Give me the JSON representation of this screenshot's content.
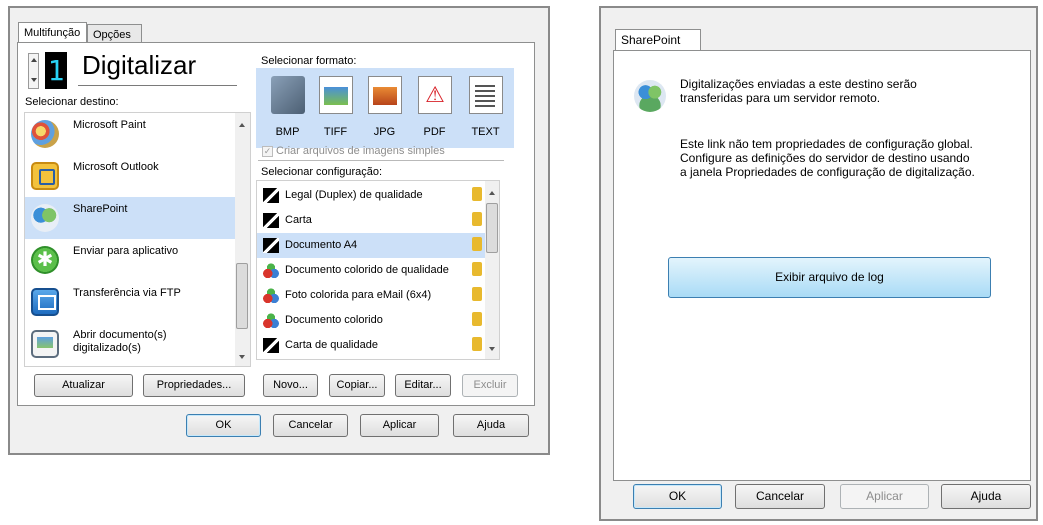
{
  "left_dialog": {
    "tabs": [
      "Multifunção",
      "Opções"
    ],
    "digit": "1",
    "title": "Digitalizar",
    "select_destination_label": "Selecionar destino:",
    "destinations": [
      {
        "label": "Microsoft Paint",
        "icon": "paint-icon"
      },
      {
        "label": "Microsoft Outlook",
        "icon": "outlook-icon"
      },
      {
        "label": "SharePoint",
        "icon": "sharepoint-icon",
        "selected": true
      },
      {
        "label": "Enviar para aplicativo",
        "icon": "send-app-icon"
      },
      {
        "label": "Transferência via FTP",
        "icon": "ftp-icon"
      },
      {
        "label": "Abrir documento(s) digitalizado(s)",
        "icon": "open-document-icon"
      }
    ],
    "select_format_label": "Selecionar formato:",
    "formats": [
      "BMP",
      "TIFF",
      "JPG",
      "PDF",
      "TEXT"
    ],
    "single_image_checkbox": "Criar arquivos de imagens simples",
    "select_config_label": "Selecionar configuração:",
    "configs": [
      {
        "label": "Legal (Duplex) de qualidade",
        "kind": "bw"
      },
      {
        "label": "Carta",
        "kind": "bw"
      },
      {
        "label": "Documento A4",
        "kind": "bw",
        "selected": true
      },
      {
        "label": "Documento colorido de qualidade",
        "kind": "color"
      },
      {
        "label": "Foto colorida para eMail (6x4)",
        "kind": "color"
      },
      {
        "label": "Documento colorido",
        "kind": "color"
      },
      {
        "label": "Carta de qualidade",
        "kind": "bw"
      }
    ],
    "buttons": {
      "update": "Atualizar",
      "properties": "Propriedades...",
      "new": "Novo...",
      "copy": "Copiar...",
      "edit": "Editar...",
      "delete": "Excluir",
      "ok": "OK",
      "cancel": "Cancelar",
      "apply": "Aplicar",
      "help": "Ajuda"
    }
  },
  "right_dialog": {
    "tab": "SharePoint",
    "description_line1": "Digitalizações enviadas a este destino serão",
    "description_line2": "transferidas para um servidor remoto.",
    "info_line1": "Este link não tem propriedades de configuração global.",
    "info_line2": "Configure as definições do servidor de destino usando",
    "info_line3": "a janela Propriedades de configuração de digitalização.",
    "log_button": "Exibir arquivo de log",
    "buttons": {
      "ok": "OK",
      "cancel": "Cancelar",
      "apply": "Aplicar",
      "help": "Ajuda"
    }
  },
  "colors": {
    "selection": "#cce0f8",
    "digit_color": "#29d2f5",
    "log_button": "#a9dbf6"
  }
}
